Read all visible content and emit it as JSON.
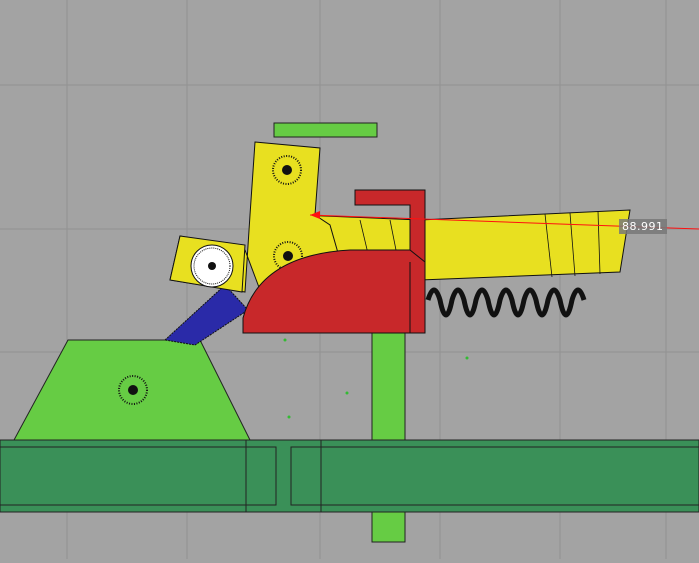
{
  "viewport": {
    "background": "#a3a3a3",
    "grid_color": "#8f8f8f",
    "measurement_readout": "88.991"
  },
  "colors": {
    "yellow_part": "#e8e020",
    "red_part": "#c8282a",
    "green_base": "#66cc44",
    "dark_green_rail": "#3a9058",
    "blue_spring": "#2a2aa8",
    "black_spring": "#111111",
    "measure_line": "#ff1010"
  }
}
